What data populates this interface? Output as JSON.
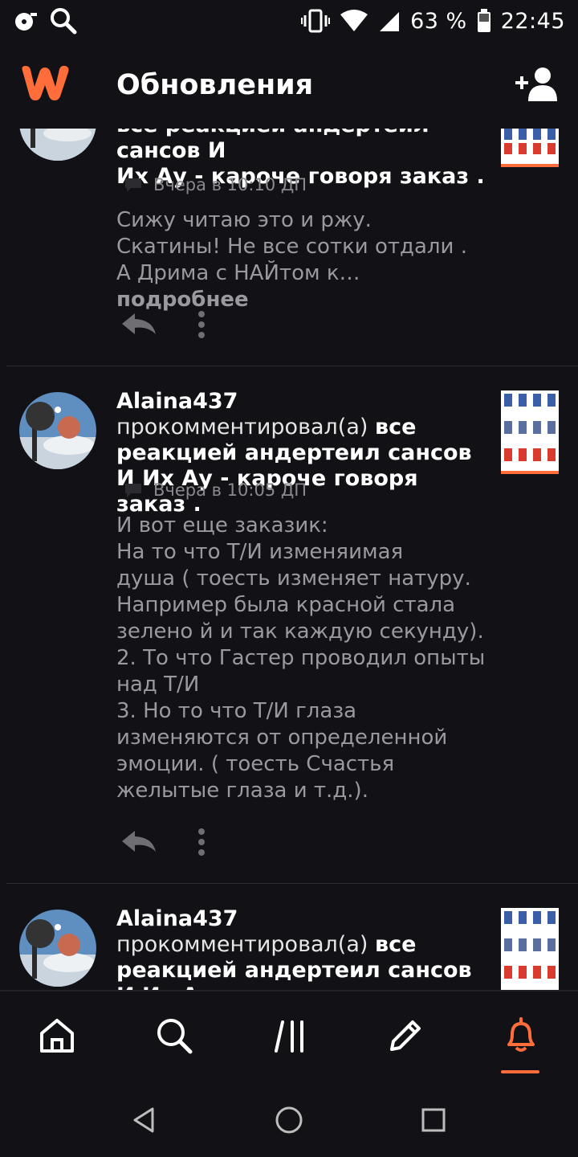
{
  "status_bar": {
    "battery": "63 %",
    "time": "22:45"
  },
  "app_bar": {
    "title": "Обновления"
  },
  "items": [
    {
      "head_partial": "все реакцией андертеил сансов И",
      "story_line2": "Их Ау - кароче говоря заказ .",
      "timestamp": "Вчера в 10:10 ДП",
      "body": "Сижу читаю это и ржу.\nСкатины! Не все сотки отдали .\nА Дрима с НАЙтом к…",
      "more": "подробнее"
    },
    {
      "user": "Alaina437",
      "action": "прокомментировал(а)",
      "story": "все реакцией андертеил сансов И Их Ау - кароче говоря заказ .",
      "timestamp": "Вчера в 10:05 ДП",
      "body": "И вот еще заказик:\nНа то что Т/И изменяимая\nдуша ( тоесть изменяет натуру.\nНапример была красной стала\nзелено й и так каждую секунду).\n2. То что Гастер проводил опыты\nнад Т/И\n3. Но то что Т/И глаза\nизменяются от определенной\nэмоции. ( тоесть Счастья\nжелытые глаза и т.д.)."
    },
    {
      "user": "Alaina437",
      "action": "прокомментировал(а)",
      "story": "все реакцией андертеил сансов И Их Ау - кароче говоря заказ ."
    }
  ],
  "icons": {
    "accent": "#ff6d3a",
    "nav": [
      "home-icon",
      "search-icon",
      "library-icon",
      "write-icon",
      "notifications-icon"
    ]
  }
}
